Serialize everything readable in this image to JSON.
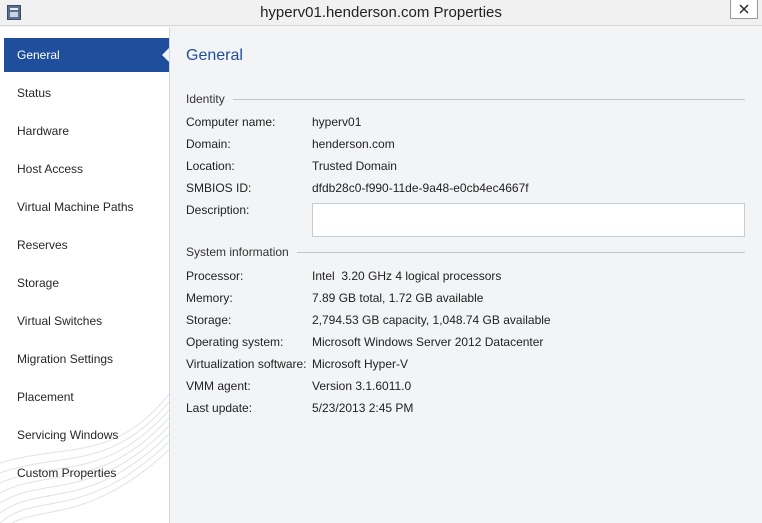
{
  "window": {
    "title": "hyperv01.henderson.com Properties"
  },
  "sidebar": {
    "items": [
      {
        "label": "General"
      },
      {
        "label": "Status"
      },
      {
        "label": "Hardware"
      },
      {
        "label": "Host Access"
      },
      {
        "label": "Virtual Machine Paths"
      },
      {
        "label": "Reserves"
      },
      {
        "label": "Storage"
      },
      {
        "label": "Virtual Switches"
      },
      {
        "label": "Migration Settings"
      },
      {
        "label": "Placement"
      },
      {
        "label": "Servicing Windows"
      },
      {
        "label": "Custom Properties"
      }
    ],
    "active_item": "General"
  },
  "main": {
    "title": "General",
    "identity": {
      "heading": "Identity",
      "computer_name": {
        "label": "Computer name:",
        "value": "hyperv01"
      },
      "domain": {
        "label": "Domain:",
        "value": "henderson.com"
      },
      "location": {
        "label": "Location:",
        "value": "Trusted Domain"
      },
      "smbios": {
        "label": "SMBIOS ID:",
        "value": "dfdb28c0-f990-11de-9a48-e0cb4ec4667f"
      },
      "description": {
        "label": "Description:",
        "value": ""
      }
    },
    "system": {
      "heading": "System information",
      "processor": {
        "label": "Processor:",
        "value": "Intel  3.20 GHz 4 logical processors"
      },
      "memory": {
        "label": "Memory:",
        "value": "7.89 GB total, 1.72 GB available"
      },
      "storage": {
        "label": "Storage:",
        "value": "2,794.53 GB capacity, 1,048.74 GB available"
      },
      "os": {
        "label": "Operating system:",
        "value": "Microsoft Windows Server 2012 Datacenter"
      },
      "virt": {
        "label": "Virtualization software:",
        "value": "Microsoft Hyper-V"
      },
      "agent": {
        "label": "VMM agent:",
        "value": "Version 3.1.6011.0"
      },
      "last_update": {
        "label": "Last update:",
        "value": "5/23/2013 2:45 PM"
      }
    }
  },
  "colors": {
    "accent": "#1f4e9c",
    "sidebar_bg": "#ffffff",
    "content_bg": "#f2f4f6"
  },
  "icons": {
    "app": "server-properties-icon",
    "close": "close-icon"
  }
}
